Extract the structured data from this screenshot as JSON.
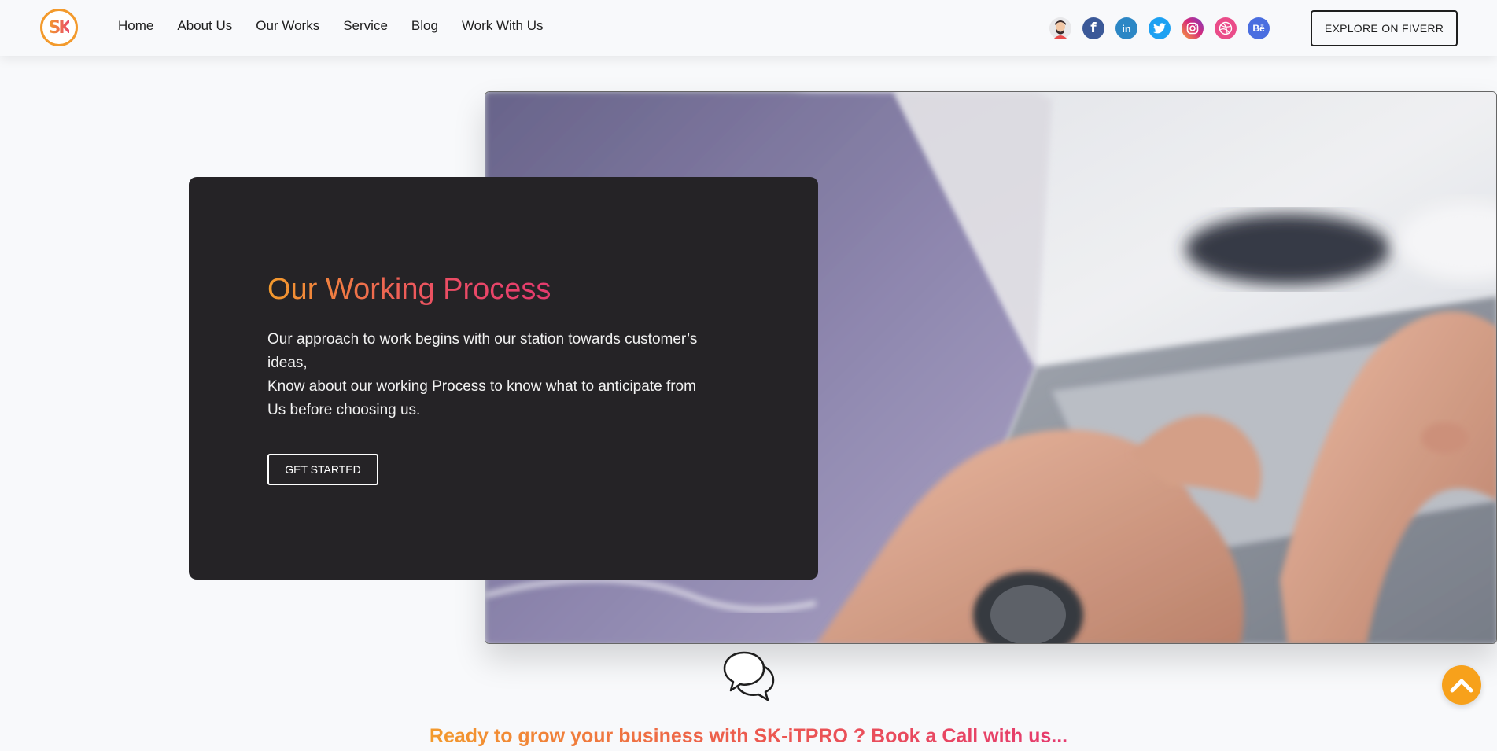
{
  "header": {
    "logo_text": "SK",
    "nav": [
      {
        "label": "Home"
      },
      {
        "label": "About Us"
      },
      {
        "label": "Our Works"
      },
      {
        "label": "Service"
      },
      {
        "label": "Blog"
      },
      {
        "label": "Work With Us"
      }
    ],
    "socials": [
      {
        "name": "avatar-icon",
        "color": "#e94b4b",
        "glyph": ""
      },
      {
        "name": "facebook-icon",
        "color": "#3b5998",
        "glyph": "f"
      },
      {
        "name": "linkedin-icon",
        "color": "#2c87c5",
        "glyph": "in"
      },
      {
        "name": "twitter-icon",
        "color": "#1da1f2",
        "glyph": ""
      },
      {
        "name": "instagram-icon",
        "color": "#c13584",
        "glyph": ""
      },
      {
        "name": "dribbble-icon",
        "color": "#ea4c89",
        "glyph": ""
      },
      {
        "name": "behance-icon",
        "color": "#4a6ee0",
        "glyph": "Bē"
      }
    ],
    "cta_label": "EXPLORE ON FIVERR"
  },
  "hero": {
    "title": "Our Working Process",
    "paragraph1": "Our approach to work begins with our station towards customer’s ideas,",
    "paragraph2": "Know about our working Process to know what to anticipate from Us before choosing us.",
    "button_label": "GET STARTED"
  },
  "footer_cta": {
    "text": "Ready to grow your business with SK-iTPRO ? Book a Call with us..."
  },
  "colors": {
    "accent_orange": "#f39a2c",
    "accent_pink": "#e53a6e",
    "card_bg": "#252326",
    "scroll_top": "#f7a11b"
  }
}
